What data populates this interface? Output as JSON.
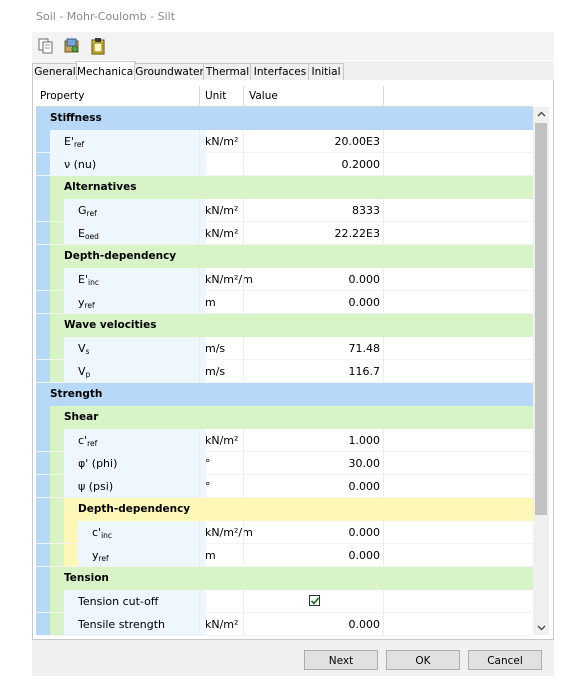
{
  "window": {
    "title": "Soil - Mohr-Coulomb - Silt"
  },
  "toolbar": {
    "icons": [
      "copy-icon",
      "load-icon",
      "clipboard-icon"
    ]
  },
  "tabs": [
    {
      "label": "General"
    },
    {
      "label": "Mechanical",
      "active": true
    },
    {
      "label": "Groundwater"
    },
    {
      "label": "Thermal"
    },
    {
      "label": "Interfaces"
    },
    {
      "label": "Initial"
    }
  ],
  "grid": {
    "headers": {
      "property": "Property",
      "unit": "Unit",
      "value": "Value"
    },
    "colors": {
      "blue": "#b8d8f8",
      "green": "#d8f4c6",
      "yellow": "#fdf8b8",
      "selection_blue": "#cfe6fb"
    },
    "rows": [
      {
        "kind": "section",
        "level": 1,
        "color": "blue",
        "title": "Stiffness"
      },
      {
        "kind": "data",
        "depth": 1,
        "main": "E'",
        "sub": "ref",
        "unit": "kN/m²",
        "value": "20.00E3"
      },
      {
        "kind": "data",
        "depth": 1,
        "main": "ν (nu)",
        "sub": "",
        "unit": "",
        "value": "0.2000"
      },
      {
        "kind": "section",
        "level": 2,
        "color": "green",
        "title": "Alternatives"
      },
      {
        "kind": "data",
        "depth": 2,
        "main": "G",
        "sub": "ref",
        "unit": "kN/m²",
        "value": "8333"
      },
      {
        "kind": "data",
        "depth": 2,
        "main": "E",
        "sub": "oed",
        "unit": "kN/m²",
        "value": "22.22E3"
      },
      {
        "kind": "section",
        "level": 2,
        "color": "green",
        "title": "Depth-dependency"
      },
      {
        "kind": "data",
        "depth": 2,
        "main": "E'",
        "sub": "inc",
        "unit": "kN/m²/m",
        "value": "0.000"
      },
      {
        "kind": "data",
        "depth": 2,
        "main": "y",
        "sub": "ref",
        "unit": "m",
        "value": "0.000"
      },
      {
        "kind": "section",
        "level": 2,
        "color": "green",
        "title": "Wave velocities"
      },
      {
        "kind": "data",
        "depth": 2,
        "main": "V",
        "sub": "s",
        "unit": "m/s",
        "value": "71.48"
      },
      {
        "kind": "data",
        "depth": 2,
        "main": "V",
        "sub": "p",
        "unit": "m/s",
        "value": "116.7"
      },
      {
        "kind": "section",
        "level": 1,
        "color": "blue",
        "title": "Strength"
      },
      {
        "kind": "section",
        "level": 2,
        "color": "green",
        "title": "Shear"
      },
      {
        "kind": "data",
        "depth": 2,
        "main": "c'",
        "sub": "ref",
        "unit": "kN/m²",
        "value": "1.000"
      },
      {
        "kind": "data",
        "depth": 2,
        "main": "φ' (phi)",
        "sub": "",
        "unit": "°",
        "value": "30.00"
      },
      {
        "kind": "data",
        "depth": 2,
        "main": "ψ (psi)",
        "sub": "",
        "unit": "°",
        "value": "0.000"
      },
      {
        "kind": "section",
        "level": 3,
        "color": "yellow",
        "title": "Depth-dependency"
      },
      {
        "kind": "data",
        "depth": 3,
        "main": "c'",
        "sub": "inc",
        "unit": "kN/m²/m",
        "value": "0.000"
      },
      {
        "kind": "data",
        "depth": 3,
        "main": "y",
        "sub": "ref",
        "unit": "m",
        "value": "0.000"
      },
      {
        "kind": "section",
        "level": 2,
        "color": "green",
        "title": "Tension"
      },
      {
        "kind": "data",
        "depth": 2,
        "main": "Tension cut-off",
        "sub": "",
        "unit": "",
        "value": "",
        "checkbox": true,
        "checked": true
      },
      {
        "kind": "data",
        "depth": 2,
        "main": "Tensile strength",
        "sub": "",
        "unit": "kN/m²",
        "value": "0.000"
      }
    ]
  },
  "buttons": {
    "next": "Next",
    "ok": "OK",
    "cancel": "Cancel"
  }
}
